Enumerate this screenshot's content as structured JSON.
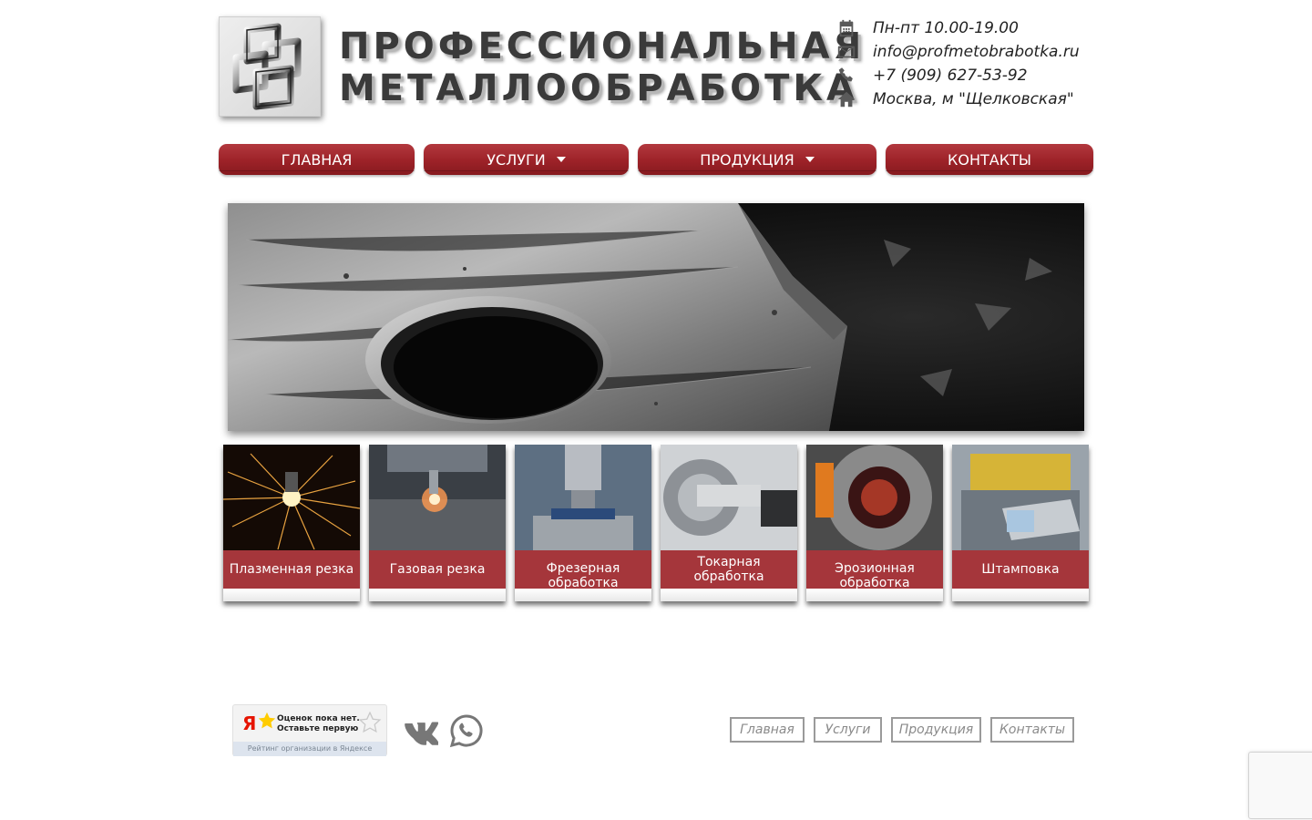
{
  "header": {
    "title_line1": "ПРОФЕССИОНАЛЬНАЯ",
    "title_line2": "МЕТАЛЛООБРАБОТКА",
    "contacts": [
      {
        "icon": "calendar-icon",
        "text": "Пн-пт 10.00-19.00"
      },
      {
        "icon": "envelope-icon",
        "text": "info@profmetobrabotka.ru"
      },
      {
        "icon": "phone-icon",
        "text": "+7 (909) 627-53-92"
      },
      {
        "icon": "home-icon",
        "text": "Москва, м \"Щелковская\""
      }
    ]
  },
  "nav": {
    "items": [
      {
        "label": "ГЛАВНАЯ",
        "dropdown": false
      },
      {
        "label": "УСЛУГИ",
        "dropdown": true
      },
      {
        "label": "ПРОДУКЦИЯ",
        "dropdown": true
      },
      {
        "label": "КОНТАКТЫ",
        "dropdown": false
      }
    ]
  },
  "services": [
    {
      "label": "Плазменная резка",
      "image": "plasma-cutting-image"
    },
    {
      "label": "Газовая резка",
      "image": "gas-cutting-image"
    },
    {
      "label": "Фрезерная обработка",
      "image": "milling-image"
    },
    {
      "label": "Токарная обработка",
      "image": "turning-image"
    },
    {
      "label": "Эрозионная обработка",
      "image": "erosion-image"
    },
    {
      "label": "Штамповка",
      "image": "stamping-image"
    }
  ],
  "footer": {
    "yandex_badge": {
      "logo": "Я",
      "line1": "Оценок пока нет.",
      "line2": "Оставьте первую",
      "caption": "Рейтинг организации в Яндексе"
    },
    "social": [
      "vk-icon",
      "whatsapp-icon"
    ],
    "links": [
      "Главная",
      "Услуги",
      "Продукция",
      "Контакты"
    ]
  },
  "colors": {
    "accent": "#9d2228",
    "title": "#3a3a3a",
    "footer_link": "#8a8a8a"
  }
}
